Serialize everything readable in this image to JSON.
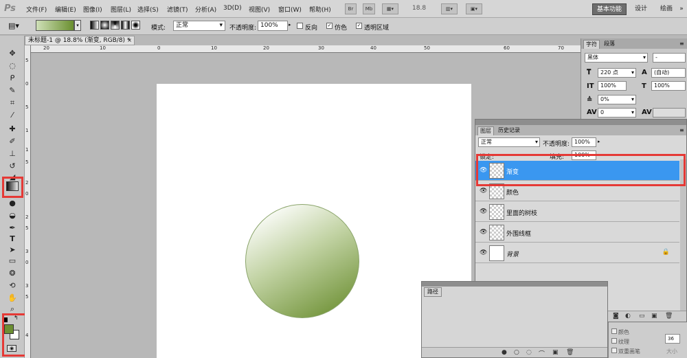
{
  "app": {
    "logo": "Ps"
  },
  "menu": [
    "文件(F)",
    "编辑(E)",
    "图像(I)",
    "图层(L)",
    "选择(S)",
    "滤镜(T)",
    "分析(A)",
    "3D(D)",
    "视图(V)",
    "窗口(W)",
    "帮助(H)"
  ],
  "menubar_icons": {
    "bridge": "Br",
    "mini_bridge": "Mb",
    "zoom": "18.8"
  },
  "workspaces": {
    "active": "基本功能",
    "design": "设计",
    "painting": "绘画"
  },
  "options": {
    "mode_label": "模式:",
    "mode_value": "正常",
    "opacity_label": "不透明度:",
    "opacity_value": "100%",
    "reverse_label": "反向",
    "reverse_checked": false,
    "dither_label": "仿色",
    "dither_checked": true,
    "transparency_label": "透明区域",
    "transparency_checked": true,
    "gradient_colors": [
      "#cfe0b8",
      "#6a8f2f"
    ]
  },
  "document": {
    "tab_title": "未标题-1 @ 18.8% (渐变, RGB/8) *",
    "close": "×"
  },
  "ruler_top_labels": [
    "20",
    "10",
    "0",
    "10",
    "20",
    "30",
    "40",
    "50",
    "60",
    "70"
  ],
  "ruler_left_labels": [
    "5",
    "0",
    "5",
    "1",
    "1",
    "5",
    "2",
    "0",
    "2",
    "5",
    "3",
    "0",
    "3",
    "5",
    "4"
  ],
  "colors": {
    "foreground": "#6c8f32",
    "background": "#ffffff",
    "selection": "#3a97f0",
    "highlight": "#e53935"
  },
  "character_panel": {
    "tabs": [
      "字符",
      "段落"
    ],
    "font_family": "黑体",
    "font_style": "-",
    "font_size": "220 点",
    "leading": "(自动)",
    "vertical_scale": "100%",
    "horizontal_scale": "100%",
    "tracking": "0%",
    "kerning": "0"
  },
  "layers_panel": {
    "tabs": [
      "图层",
      "历史记录"
    ],
    "blend_mode": "正常",
    "opacity_label": "不透明度:",
    "opacity_value": "100%",
    "lock_label": "锁定:",
    "fill_label": "填充:",
    "fill_value": "100%",
    "layers": [
      {
        "name": "渐变",
        "selected": true
      },
      {
        "name": "颜色",
        "selected": false
      },
      {
        "name": "里面的树枝",
        "selected": false
      },
      {
        "name": "外围线框",
        "selected": false
      },
      {
        "name": "背景",
        "selected": false,
        "locked": true
      }
    ]
  },
  "paths_panel": {
    "tab": "路径"
  },
  "styles_panel": {
    "items": [
      "颜色",
      "纹理",
      "双重画笔"
    ],
    "size_label": "大小",
    "size_value": "36"
  }
}
